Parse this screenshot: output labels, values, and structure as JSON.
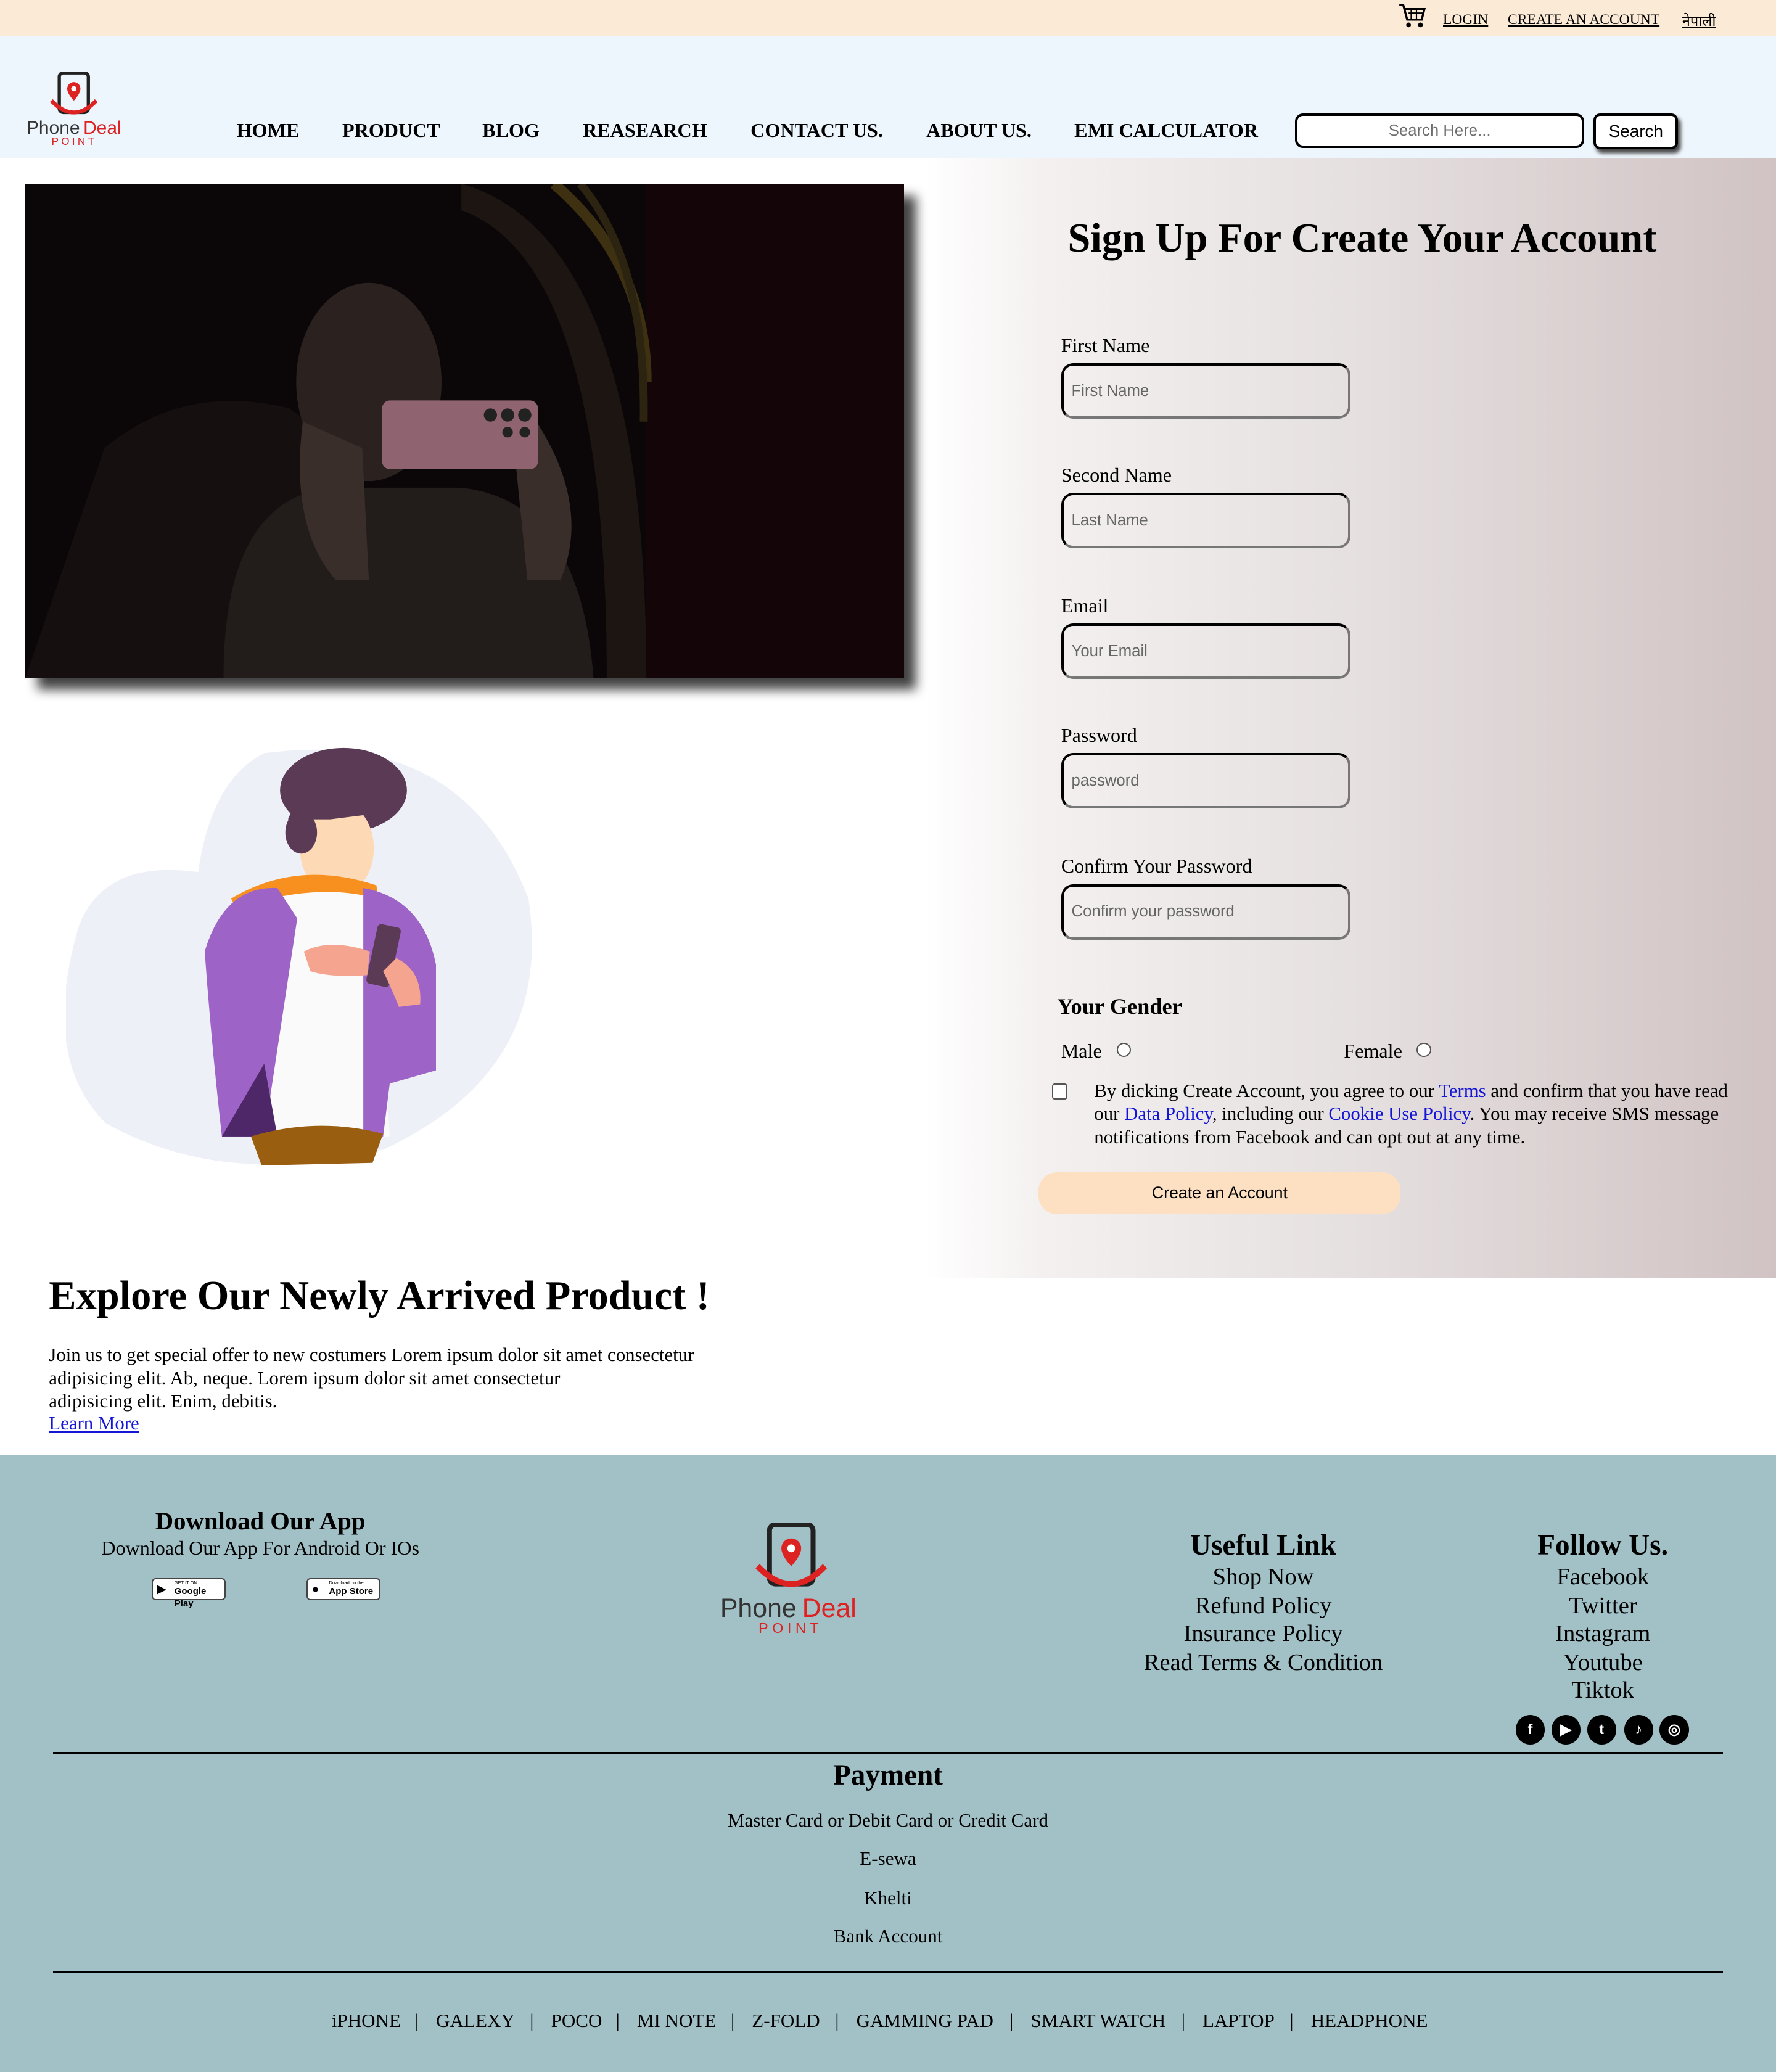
{
  "topbar": {
    "cart_icon": "shopping-cart-icon",
    "login": "LOGIN",
    "create_account": "CREATE AN ACCOUNT",
    "language": "नेपाली",
    "background": "#fbebd6"
  },
  "header": {
    "logo": {
      "word1": "Phone",
      "word2": "Deal",
      "word3": "POINT"
    },
    "nav": [
      "HOME",
      "PRODUCT",
      "BLOG",
      "REASEARCH",
      "CONTACT US.",
      "ABOUT US.",
      "EMI CALCULATOR"
    ],
    "search_placeholder": "Search Here...",
    "search_button": "Search",
    "background": "#eef6fd"
  },
  "form": {
    "title": "Sign Up For Create Your Account",
    "fields": [
      {
        "label": "First Name",
        "placeholder": "First Name"
      },
      {
        "label": "Second Name",
        "placeholder": "Last Name"
      },
      {
        "label": "Email",
        "placeholder": "Your Email"
      },
      {
        "label": "Password",
        "placeholder": "password"
      },
      {
        "label": "Confirm Your Password",
        "placeholder": "Confirm your password"
      }
    ],
    "gender_title": "Your Gender",
    "gender_options": [
      "Male",
      "Female"
    ],
    "agreement": {
      "part1": "By dicking Create Account, you agree to our ",
      "terms": "Terms",
      "part2": " and confirm that you have read our ",
      "data_policy": "Data Policy",
      "part3": ", including our ",
      "cookie_policy": "Cookie Use Policy",
      "part4": ". You may receive SMS message notifications from Facebook and can opt out at any time."
    },
    "submit": "Create an Account",
    "link_color": "#1515d6",
    "button_color": "#fde0c2"
  },
  "explore": {
    "title": "Explore Our Newly Arrived Product !",
    "text_line1": "Join us to get special offer to new costumers Lorem ipsum dolor sit amet consectetur",
    "text_line2": "adipisicing elit. Ab, neque. Lorem ipsum dolor sit amet consectetur",
    "text_line3": "adipisicing elit. Enim, debitis.",
    "link": "Learn More"
  },
  "footer": {
    "background": "#a2c1c7",
    "download": {
      "title": "Download Our App",
      "subtitle": "Download Our App For Android Or IOs",
      "google_small": "GET IT ON",
      "google_big": "Google Play",
      "apple_small": "Download on the",
      "apple_big": "App Store"
    },
    "useful": {
      "title": "Useful Link",
      "links": [
        "Shop Now",
        "Refund Policy",
        "Insurance Policy",
        "Read Terms & Condition"
      ]
    },
    "follow": {
      "title": "Follow Us.",
      "links": [
        "Facebook",
        "Twitter",
        "Instagram",
        "Youtube",
        "Tiktok"
      ],
      "icons": [
        "facebook-icon",
        "youtube-icon",
        "twitter-icon",
        "tiktok-icon",
        "instagram-icon"
      ]
    },
    "payment": {
      "title": "Payment",
      "methods": [
        "Master Card or Debit Card or Credit Card",
        "E-sewa",
        "Khelti",
        "Bank Account"
      ]
    },
    "bottom_nav": [
      "iPHONE",
      "GALEXY",
      "POCO",
      "MI NOTE",
      "Z-FOLD",
      "GAMMING PAD",
      "SMART WATCH",
      "LAPTOP",
      "HEADPHONE"
    ]
  }
}
